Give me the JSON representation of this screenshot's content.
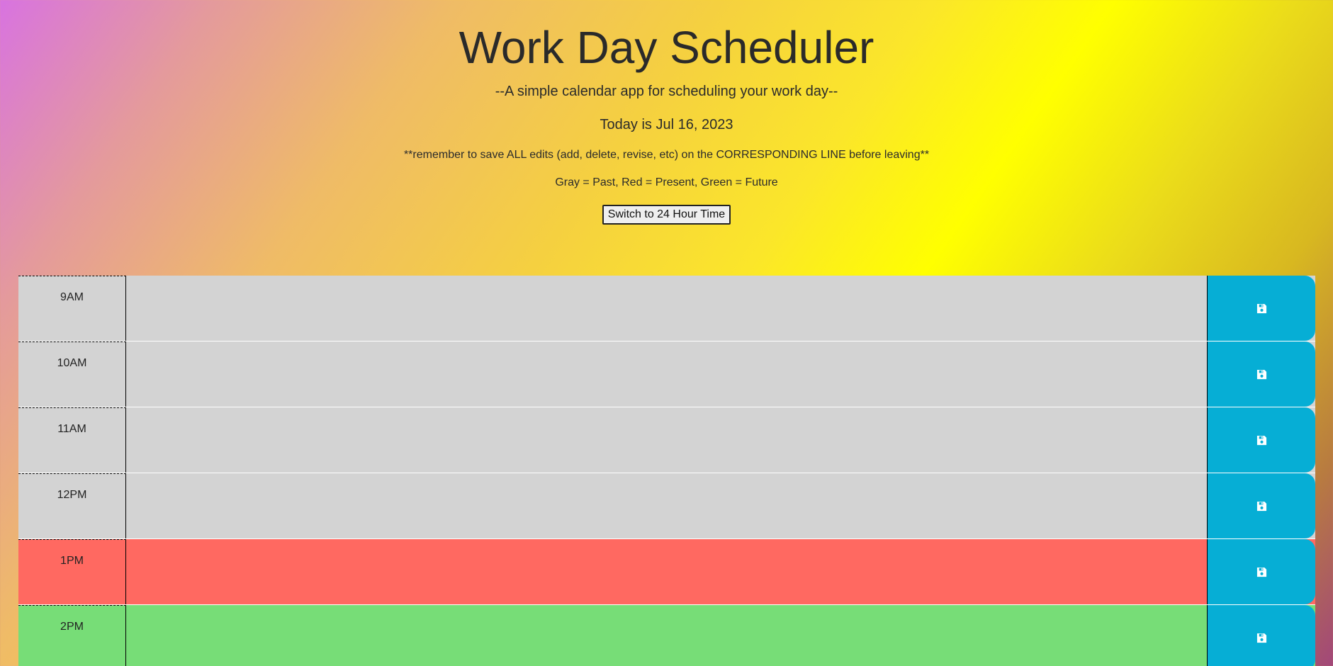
{
  "header": {
    "title": "Work Day Scheduler",
    "subtitle": "--A simple calendar app for scheduling your work day--",
    "today": "Today is Jul 16, 2023",
    "reminder": "**remember to save ALL edits (add, delete, revise, etc) on the CORRESPONDING LINE before leaving**",
    "legend": "Gray = Past, Red = Present, Green = Future",
    "toggle_label": "Switch to 24 Hour Time"
  },
  "colors": {
    "past": "#d3d3d3",
    "present": "#ff6961",
    "future": "#77dd77",
    "save": "#06aed5"
  },
  "rows": [
    {
      "hour": "9AM",
      "status": "past",
      "text": ""
    },
    {
      "hour": "10AM",
      "status": "past",
      "text": ""
    },
    {
      "hour": "11AM",
      "status": "past",
      "text": ""
    },
    {
      "hour": "12PM",
      "status": "past",
      "text": ""
    },
    {
      "hour": "1PM",
      "status": "present",
      "text": ""
    },
    {
      "hour": "2PM",
      "status": "future",
      "text": ""
    }
  ],
  "icons": {
    "save": "floppy-disk-icon"
  }
}
